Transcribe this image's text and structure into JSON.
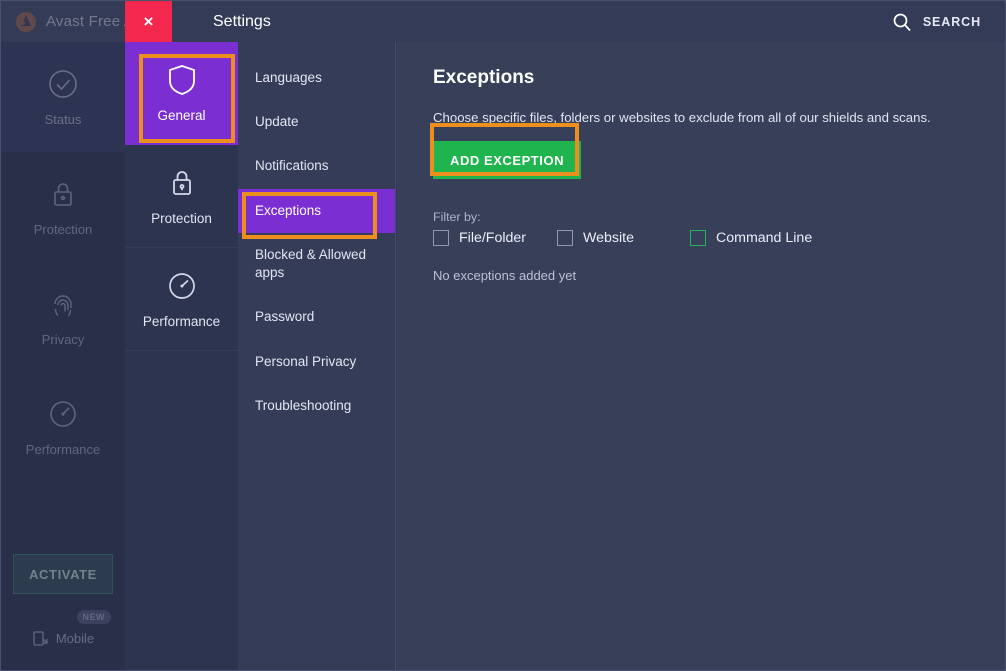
{
  "background_app": {
    "brand": "Avast Free Antivirus",
    "logo_icon": "avast-logo-icon",
    "nav": [
      {
        "label": "Status",
        "icon": "check-circle-icon"
      },
      {
        "label": "Protection",
        "icon": "lock-icon"
      },
      {
        "label": "Privacy",
        "icon": "fingerprint-icon"
      },
      {
        "label": "Performance",
        "icon": "gauge-icon"
      }
    ],
    "activate_label": "ACTIVATE",
    "mobile_label": "Mobile",
    "mobile_icon": "mobile-device-icon",
    "new_badge": "NEW"
  },
  "modal": {
    "title": "Settings",
    "close_icon": "close-x-icon",
    "close_label": "×",
    "search": {
      "label": "SEARCH",
      "icon": "search-icon"
    },
    "categories": [
      {
        "label": "General",
        "icon": "shield-icon",
        "selected": true
      },
      {
        "label": "Protection",
        "icon": "lock-icon",
        "selected": false
      },
      {
        "label": "Performance",
        "icon": "gauge-icon",
        "selected": false
      }
    ],
    "nav_items": [
      {
        "label": "Languages",
        "selected": false
      },
      {
        "label": "Update",
        "selected": false
      },
      {
        "label": "Notifications",
        "selected": false
      },
      {
        "label": "Exceptions",
        "selected": true
      },
      {
        "label": "Blocked & Allowed apps",
        "selected": false
      },
      {
        "label": "Password",
        "selected": false
      },
      {
        "label": "Personal Privacy",
        "selected": false
      },
      {
        "label": "Troubleshooting",
        "selected": false
      }
    ],
    "pane": {
      "title": "Exceptions",
      "description": "Choose specific files, folders or websites to exclude from all of our shields and scans.",
      "add_button": "ADD EXCEPTION",
      "filter_label": "Filter by:",
      "filters": [
        {
          "label": "File/Folder",
          "checked": false,
          "hover": false
        },
        {
          "label": "Website",
          "checked": false,
          "hover": false
        },
        {
          "label": "Command Line",
          "checked": false,
          "hover": true
        }
      ],
      "empty_note": "No exceptions added yet"
    }
  },
  "colors": {
    "accent_purple": "#7b2fd3",
    "accent_green": "#20b44f",
    "annotation_orange": "#ec8f1e",
    "close_red": "#f4274e",
    "pane_bg": "#373f59",
    "rail_bg": "#2d3450",
    "nav_bg": "#353c58"
  }
}
